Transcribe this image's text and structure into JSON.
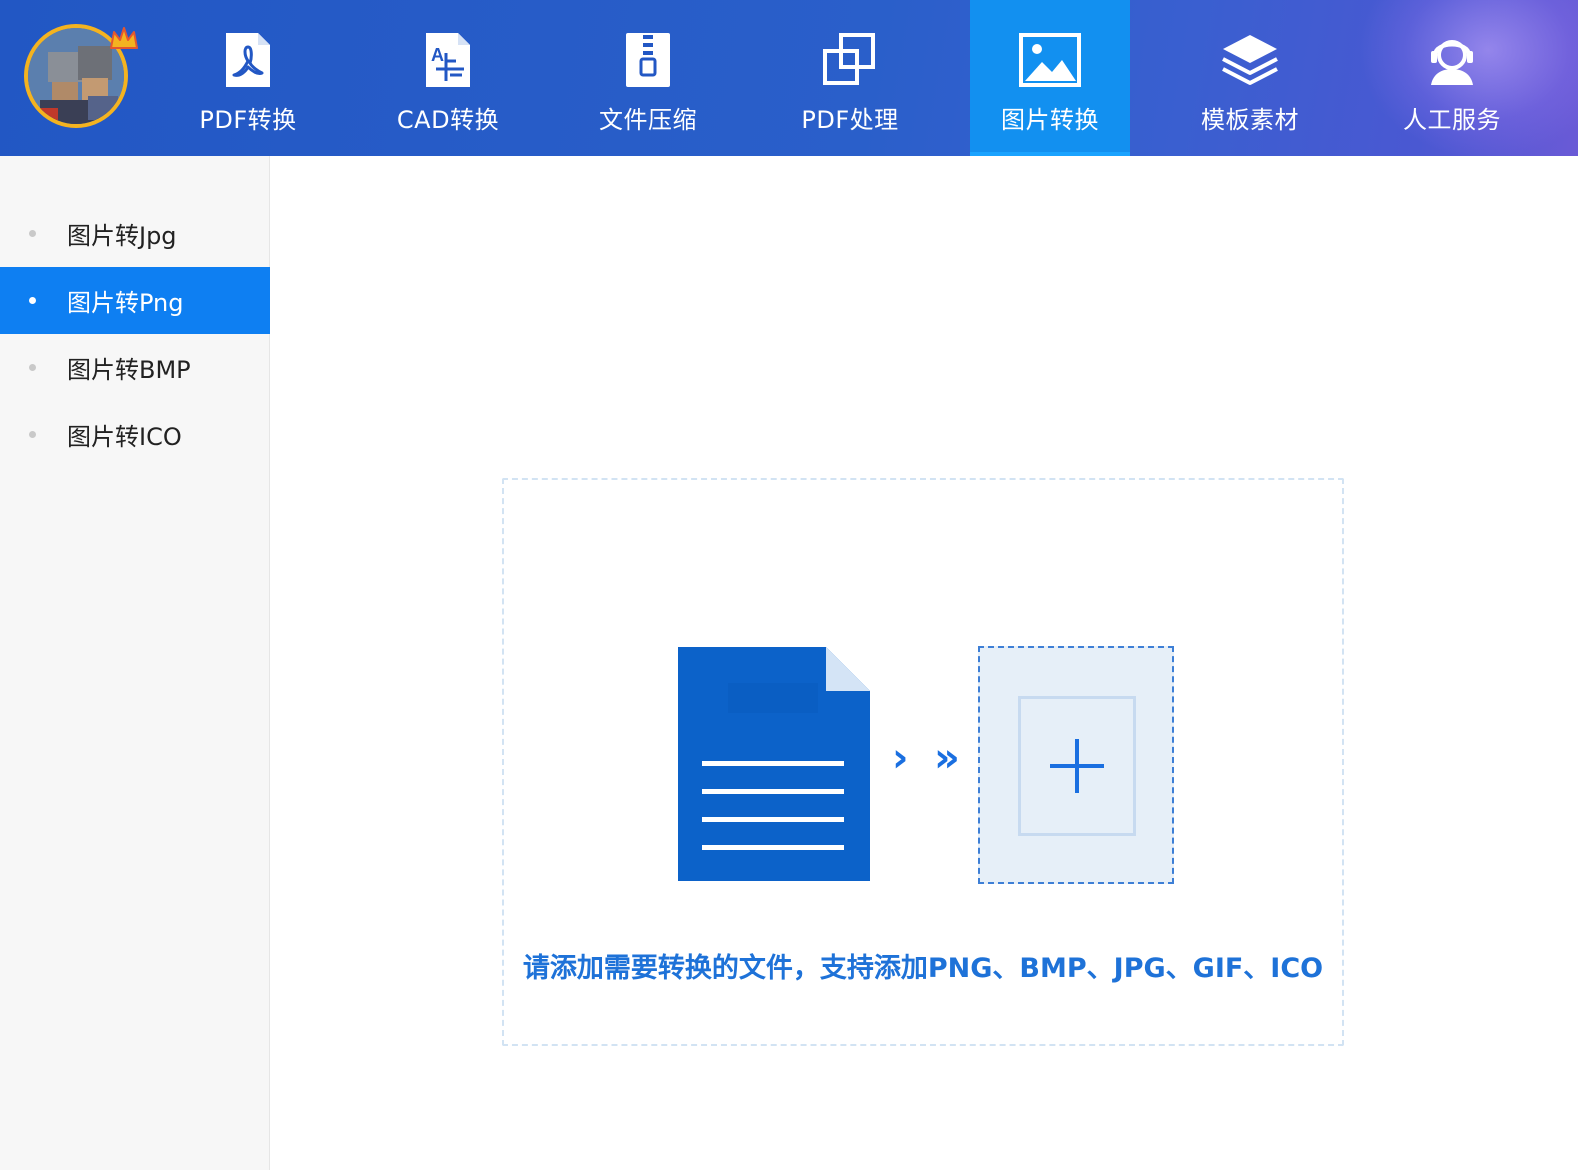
{
  "nav": {
    "items": [
      {
        "label": "PDF转换",
        "icon": "pdf-icon"
      },
      {
        "label": "CAD转换",
        "icon": "cad-icon"
      },
      {
        "label": "文件压缩",
        "icon": "zip-file-icon"
      },
      {
        "label": "PDF处理",
        "icon": "overlap-squares-icon"
      },
      {
        "label": "图片转换",
        "icon": "image-icon",
        "active": true
      },
      {
        "label": "模板素材",
        "icon": "layers-icon"
      },
      {
        "label": "人工服务",
        "icon": "customer-service-icon"
      }
    ]
  },
  "sidebar": {
    "items": [
      {
        "label": "图片转Jpg"
      },
      {
        "label": "图片转Png",
        "active": true
      },
      {
        "label": "图片转BMP"
      },
      {
        "label": "图片转ICO"
      }
    ]
  },
  "main": {
    "hint": "请添加需要转换的文件，支持添加PNG、BMP、JPG、GIF、ICO",
    "arrow_single": "›",
    "arrow_double": "»"
  },
  "colors": {
    "topbar": "#2257c4",
    "active_nav": "#1290f0",
    "active_side": "#0e7ff2",
    "accent": "#1e72d8",
    "avatar_ring": "#f4b320"
  }
}
